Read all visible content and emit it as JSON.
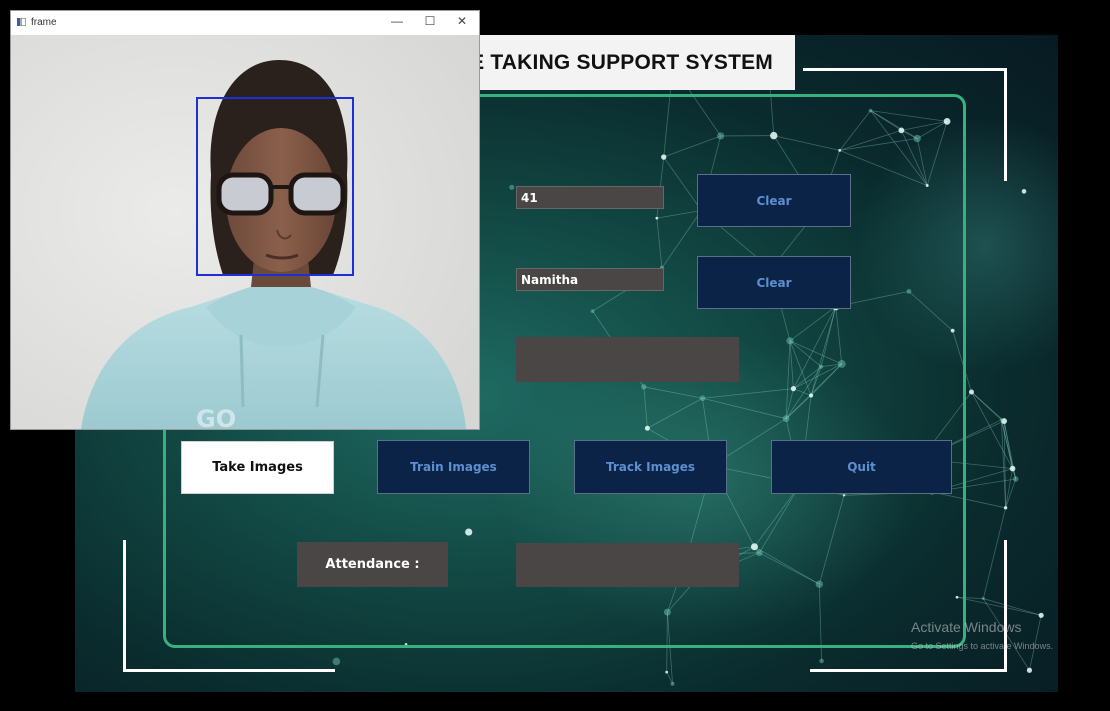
{
  "app": {
    "title": "ICE TAKING SUPPORT SYSTEM",
    "id_field": {
      "value": "41"
    },
    "name_field": {
      "value": "Namitha"
    },
    "clear_id_label": "Clear",
    "clear_name_label": "Clear",
    "notification_value": "",
    "actions": {
      "take_images": "Take Images",
      "train_images": "Train Images",
      "track_images": "Track Images",
      "quit": "Quit"
    },
    "attendance_label": "Attendance :",
    "attendance_value": ""
  },
  "frame_window": {
    "title": "frame",
    "controls": {
      "minimize": "—",
      "maximize": "☐",
      "close": "✕"
    }
  },
  "watermark": {
    "line1": "Activate Windows",
    "line2": "Go to Settings to activate Windows."
  },
  "colors": {
    "panel_border": "#37b27e",
    "button_dark": "#0b2347",
    "button_text": "#5d8fd0",
    "entry_bg": "#4a4646",
    "face_box": "#1f2fd8"
  }
}
